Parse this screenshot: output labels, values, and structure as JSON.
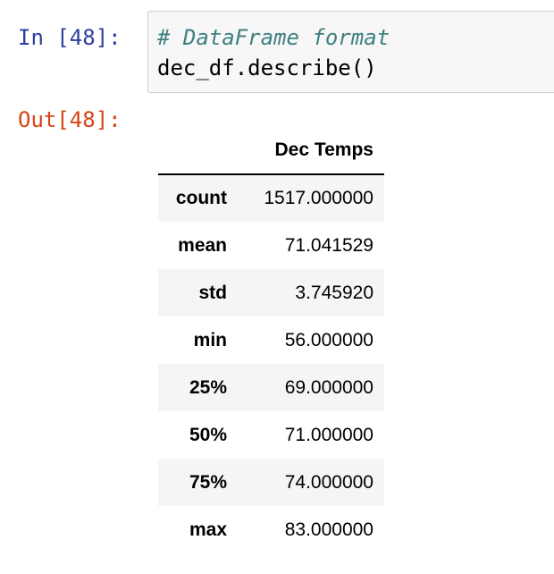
{
  "input_prompt": "In [48]:",
  "output_prompt": "Out[48]:",
  "code": {
    "comment": "# DataFrame format",
    "line": "dec_df.describe()"
  },
  "table": {
    "index_header": "",
    "column": "Dec Temps",
    "rows": [
      {
        "label": "count",
        "value": "1517.000000"
      },
      {
        "label": "mean",
        "value": "71.041529"
      },
      {
        "label": "std",
        "value": "3.745920"
      },
      {
        "label": "min",
        "value": "56.000000"
      },
      {
        "label": "25%",
        "value": "69.000000"
      },
      {
        "label": "50%",
        "value": "71.000000"
      },
      {
        "label": "75%",
        "value": "74.000000"
      },
      {
        "label": "max",
        "value": "83.000000"
      }
    ]
  }
}
